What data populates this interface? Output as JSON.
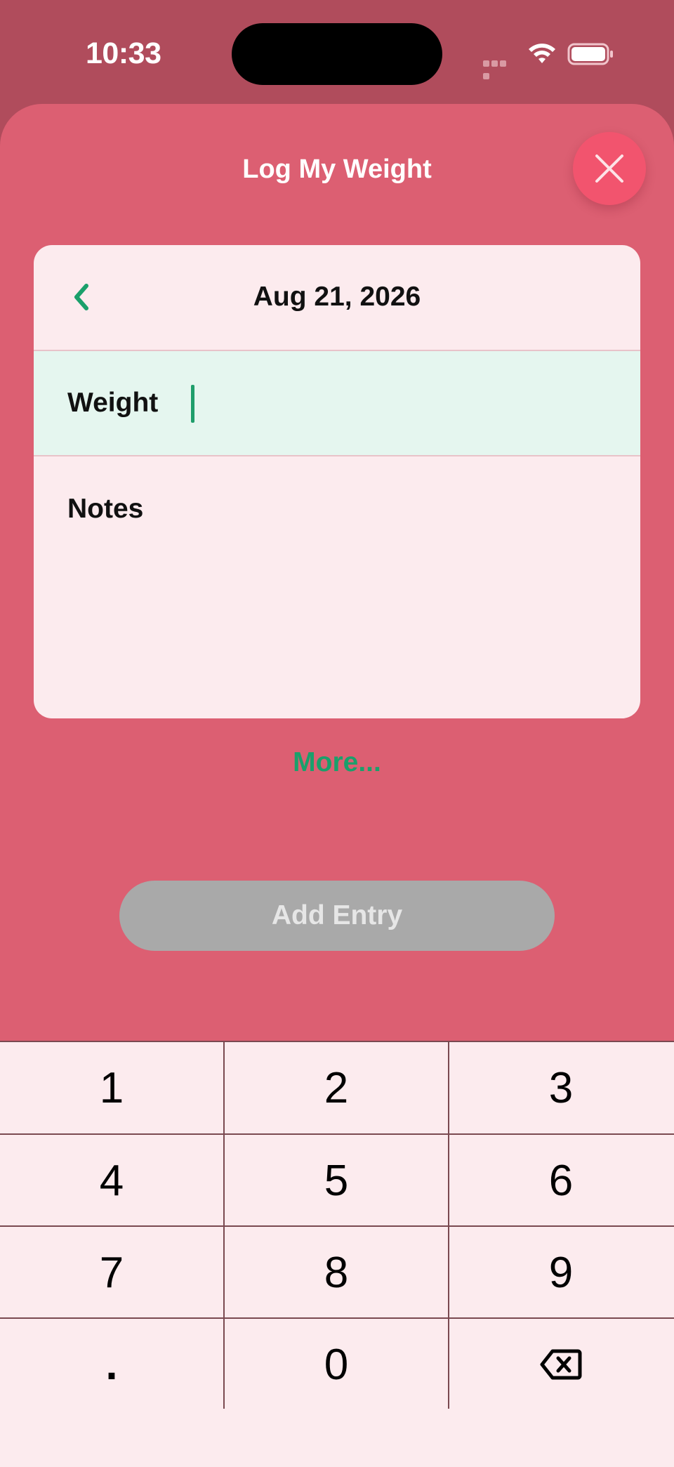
{
  "status_bar": {
    "time": "10:33"
  },
  "sheet": {
    "title": "Log My Weight",
    "date": "Aug 21, 2026",
    "weight_label": "Weight",
    "weight_value": "",
    "notes_label": "Notes",
    "more_label": "More...",
    "add_entry_label": "Add Entry"
  },
  "keypad": {
    "keys": [
      "1",
      "2",
      "3",
      "4",
      "5",
      "6",
      "7",
      "8",
      "9",
      ".",
      "0"
    ]
  },
  "colors": {
    "accent": "#1aa06b",
    "sheet_background": "#dc5f72",
    "close_button": "#f2546e",
    "weight_row_highlight": "#e5f6ef",
    "disabled_button": "#a9a9a9"
  },
  "icons": [
    "close-icon",
    "chevron-left-icon",
    "backspace-icon",
    "wifi-icon",
    "battery-icon",
    "cellular-signal-icon"
  ]
}
